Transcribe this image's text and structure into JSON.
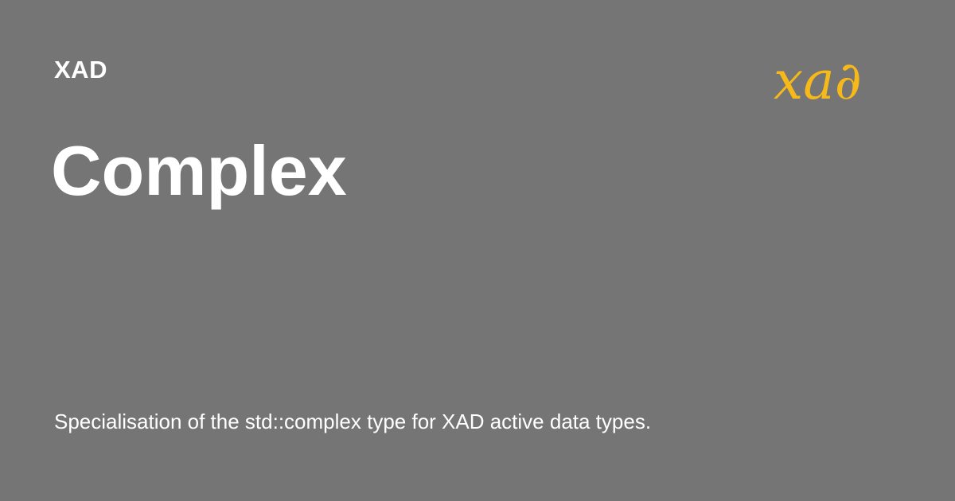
{
  "header": {
    "site_name": "XAD"
  },
  "logo": {
    "text": "xa∂",
    "color": "#f5b91a"
  },
  "page": {
    "title": "Complex",
    "description": "Specialisation of the std::complex type for XAD active data types."
  },
  "colors": {
    "background": "#757575",
    "text": "#ffffff",
    "accent": "#f5b91a"
  }
}
